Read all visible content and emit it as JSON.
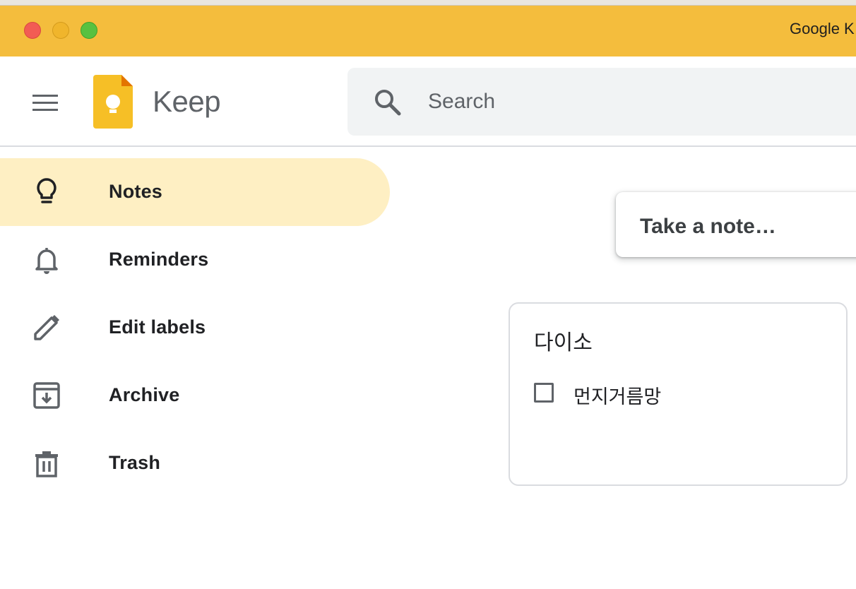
{
  "window": {
    "title": "Google K"
  },
  "header": {
    "logo_text": "Keep",
    "search_placeholder": "Search"
  },
  "sidebar": {
    "items": [
      {
        "label": "Notes",
        "icon": "lightbulb-icon",
        "active": true
      },
      {
        "label": "Reminders",
        "icon": "bell-icon",
        "active": false
      },
      {
        "label": "Edit labels",
        "icon": "pencil-icon",
        "active": false
      },
      {
        "label": "Archive",
        "icon": "archive-icon",
        "active": false
      },
      {
        "label": "Trash",
        "icon": "trash-icon",
        "active": false
      }
    ]
  },
  "composer": {
    "placeholder": "Take a note…"
  },
  "notes": [
    {
      "title": "다이소",
      "items": [
        {
          "text": "먼지거름망",
          "checked": false
        }
      ]
    }
  ],
  "colors": {
    "titlebar": "#f4bd3d",
    "active_nav": "#feefc3",
    "icon_gray": "#5f6368",
    "keep_yellow": "#f6bf26"
  }
}
